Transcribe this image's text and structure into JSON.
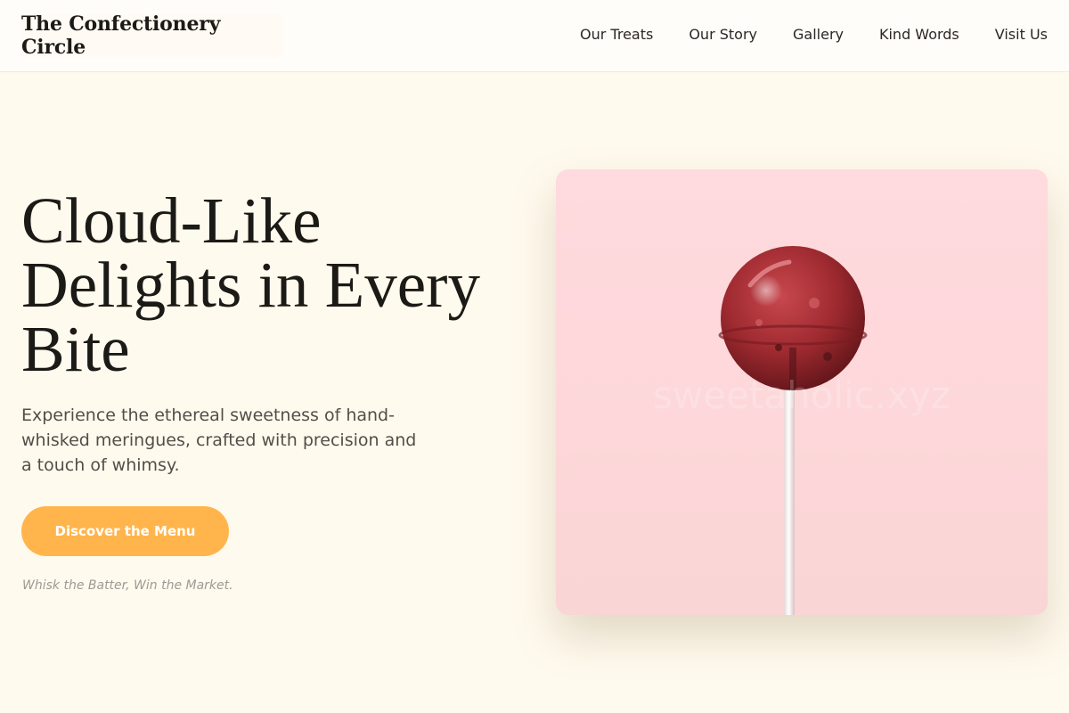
{
  "brand": {
    "name": "The Confectionery Circle"
  },
  "nav": {
    "items": [
      {
        "label": "Our Treats"
      },
      {
        "label": "Our Story"
      },
      {
        "label": "Gallery"
      },
      {
        "label": "Kind Words"
      },
      {
        "label": "Visit Us"
      }
    ]
  },
  "hero": {
    "title": "Cloud-Like Delights in Every Bite",
    "subtitle": "Experience the ethereal sweetness of hand-whisked meringues, crafted with precision and a touch of whimsy.",
    "cta_label": "Discover the Menu",
    "tagline": "Whisk the Batter, Win the Market.",
    "image": {
      "subject": "red-lollipop",
      "watermark": "sweetaholic.xyz"
    }
  },
  "colors": {
    "page_background": "#fffaee",
    "accent": "#ffb54c",
    "image_background": "#ffdade",
    "candy": "#9e2a30"
  }
}
